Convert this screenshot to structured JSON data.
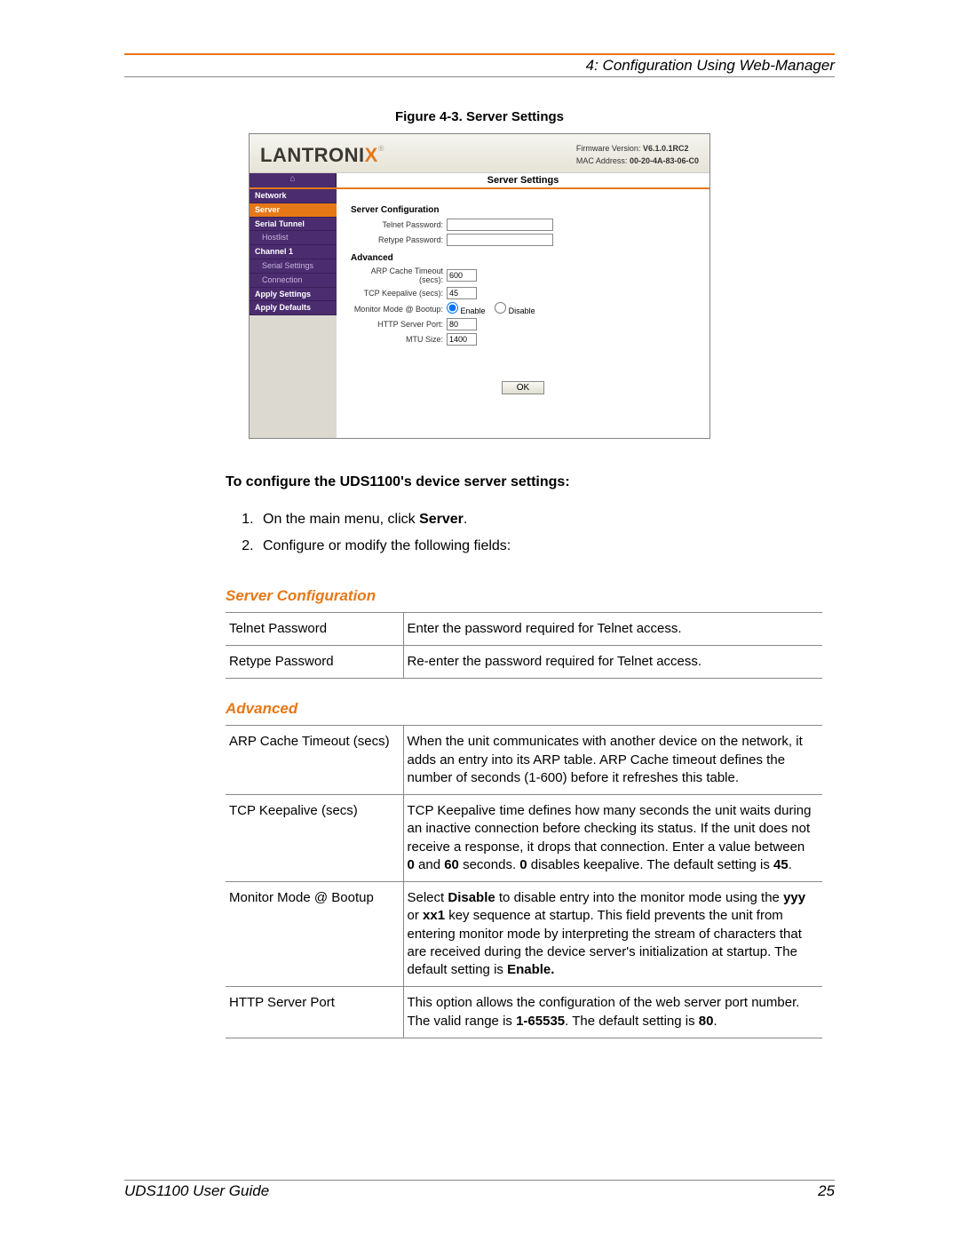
{
  "header": {
    "chapter": "4: Configuration Using Web-Manager"
  },
  "figure": {
    "caption": "Figure 4-3. Server Settings",
    "logo_main": "LANTRONI",
    "logo_x": "X",
    "firmware_label": "Firmware Version:",
    "firmware_value": "V6.1.0.1RC2",
    "mac_label": "MAC Address:",
    "mac_value": "00-20-4A-83-06-C0",
    "home_icon": "⌂",
    "title": "Server Settings",
    "nav": {
      "network": "Network",
      "server": "Server",
      "serial_tunnel": "Serial Tunnel",
      "hostlist": "Hostlist",
      "channel1": "Channel 1",
      "serial_settings": "Serial Settings",
      "connection": "Connection",
      "apply_settings": "Apply Settings",
      "apply_defaults": "Apply Defaults"
    },
    "form": {
      "section1": "Server Configuration",
      "telnet_pw": "Telnet Password:",
      "retype_pw": "Retype Password:",
      "section2": "Advanced",
      "arp": "ARP Cache Timeout (secs):",
      "arp_val": "600",
      "tcp": "TCP Keepalive (secs):",
      "tcp_val": "45",
      "monitor": "Monitor Mode @ Bootup:",
      "enable": "Enable",
      "disable": "Disable",
      "http": "HTTP Server Port:",
      "http_val": "80",
      "mtu": "MTU Size:",
      "mtu_val": "1400",
      "ok": "OK"
    }
  },
  "intro": "To configure the UDS1100's device server settings:",
  "steps": {
    "s1a": "On the main menu, click ",
    "s1b": "Server",
    "s1c": ".",
    "s2": "Configure or modify the following fields:"
  },
  "sec1_title": "Server Configuration",
  "t1": {
    "r1c1": "Telnet Password",
    "r1c2": "Enter the password required for Telnet access.",
    "r2c1": "Retype Password",
    "r2c2": "Re-enter the password required for Telnet access."
  },
  "sec2_title": "Advanced",
  "t2": {
    "r1c1": "ARP Cache Timeout (secs)",
    "r1c2": "When the unit communicates with another device on the network, it adds an entry into its ARP table. ARP Cache timeout defines the number of seconds (1-600) before it refreshes this table.",
    "r2c1": "TCP Keepalive (secs)",
    "r2c2a": "TCP Keepalive time defines how many seconds the unit waits during an inactive connection before checking its status. If the unit does not receive a response, it drops that connection. Enter a value between ",
    "r2c2b": "0",
    "r2c2c": " and ",
    "r2c2d": "60",
    "r2c2e": " seconds. ",
    "r2c2f": "0",
    "r2c2g": " disables keepalive. The default setting is ",
    "r2c2h": "45",
    "r2c2i": ".",
    "r3c1": "Monitor Mode @ Bootup",
    "r3c2a": "Select ",
    "r3c2b": "Disable",
    "r3c2c": " to disable entry into the monitor mode using the ",
    "r3c2d": "yyy",
    "r3c2e": " or ",
    "r3c2f": "xx1",
    "r3c2g": " key sequence at startup. This field prevents the unit from entering monitor mode by interpreting the stream of characters that are received during the device server's initialization at startup. The default setting is ",
    "r3c2h": "Enable.",
    "r4c1": "HTTP Server Port",
    "r4c2a": "This option allows the configuration of the web server port number. The valid range is ",
    "r4c2b": "1-65535",
    "r4c2c": ". The default setting is ",
    "r4c2d": "80",
    "r4c2e": "."
  },
  "footer": {
    "left": "UDS1100 User Guide",
    "right": "25"
  }
}
